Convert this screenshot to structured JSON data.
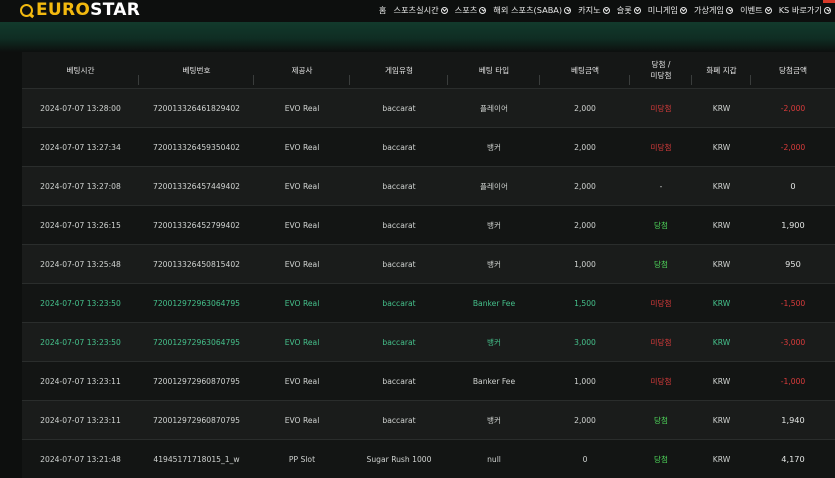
{
  "header": {
    "logo_euro": "EURO",
    "logo_star": "STAR",
    "nav": [
      {
        "label": "홈",
        "chevron": false
      },
      {
        "label": "스포츠실시간",
        "chevron": true
      },
      {
        "label": "스포츠",
        "chevron": true
      },
      {
        "label": "해외 스포츠(SABA)",
        "chevron": true
      },
      {
        "label": "카지노",
        "chevron": true
      },
      {
        "label": "슬롯",
        "chevron": true
      },
      {
        "label": "미니게임",
        "chevron": true
      },
      {
        "label": "가상게임",
        "chevron": true
      },
      {
        "label": "이벤트",
        "chevron": true
      },
      {
        "label": "KS 바로가기",
        "chevron": true
      }
    ]
  },
  "colors": {
    "logo_gold": "#f2b90f",
    "win_green": "#4ed65a",
    "lose_red": "#d93b3b",
    "highlight_row_text": "#45c08b"
  },
  "table": {
    "columns": [
      "베팅시간",
      "베팅번호",
      "제공사",
      "게임유형",
      "베팅 타입",
      "베팅금액",
      "당첨 /\n미당첨",
      "화폐 지갑",
      "당첨금액"
    ],
    "rows": [
      {
        "time": "2024-07-07 13:28:00",
        "bet_no": "720013326461829402",
        "provider": "EVO Real",
        "game": "baccarat",
        "bet_type": "플레이어",
        "amount": "2,000",
        "result": "미당첨",
        "result_class": "lose",
        "currency": "KRW",
        "win_amount": "-2,000",
        "win_class": "neg",
        "highlight": false
      },
      {
        "time": "2024-07-07 13:27:34",
        "bet_no": "720013326459350402",
        "provider": "EVO Real",
        "game": "baccarat",
        "bet_type": "뱅커",
        "amount": "2,000",
        "result": "미당첨",
        "result_class": "lose",
        "currency": "KRW",
        "win_amount": "-2,000",
        "win_class": "neg",
        "highlight": false
      },
      {
        "time": "2024-07-07 13:27:08",
        "bet_no": "720013326457449402",
        "provider": "EVO Real",
        "game": "baccarat",
        "bet_type": "플레이어",
        "amount": "2,000",
        "result": "-",
        "result_class": "",
        "currency": "KRW",
        "win_amount": "0",
        "win_class": "amt-white",
        "highlight": false
      },
      {
        "time": "2024-07-07 13:26:15",
        "bet_no": "720013326452799402",
        "provider": "EVO Real",
        "game": "baccarat",
        "bet_type": "뱅커",
        "amount": "2,000",
        "result": "당첨",
        "result_class": "win",
        "currency": "KRW",
        "win_amount": "1,900",
        "win_class": "amt-white",
        "highlight": false
      },
      {
        "time": "2024-07-07 13:25:48",
        "bet_no": "720013326450815402",
        "provider": "EVO Real",
        "game": "baccarat",
        "bet_type": "뱅커",
        "amount": "1,000",
        "result": "당첨",
        "result_class": "win",
        "currency": "KRW",
        "win_amount": "950",
        "win_class": "amt-white",
        "highlight": false
      },
      {
        "time": "2024-07-07 13:23:50",
        "bet_no": "720012972963064795",
        "provider": "EVO Real",
        "game": "baccarat",
        "bet_type": "Banker Fee",
        "amount": "1,500",
        "result": "미당첨",
        "result_class": "lose",
        "currency": "KRW",
        "win_amount": "-1,500",
        "win_class": "neg",
        "highlight": true
      },
      {
        "time": "2024-07-07 13:23:50",
        "bet_no": "720012972963064795",
        "provider": "EVO Real",
        "game": "baccarat",
        "bet_type": "뱅커",
        "amount": "3,000",
        "result": "미당첨",
        "result_class": "lose",
        "currency": "KRW",
        "win_amount": "-3,000",
        "win_class": "neg",
        "highlight": true
      },
      {
        "time": "2024-07-07 13:23:11",
        "bet_no": "720012972960870795",
        "provider": "EVO Real",
        "game": "baccarat",
        "bet_type": "Banker Fee",
        "amount": "1,000",
        "result": "미당첨",
        "result_class": "lose",
        "currency": "KRW",
        "win_amount": "-1,000",
        "win_class": "neg",
        "highlight": false
      },
      {
        "time": "2024-07-07 13:23:11",
        "bet_no": "720012972960870795",
        "provider": "EVO Real",
        "game": "baccarat",
        "bet_type": "뱅커",
        "amount": "2,000",
        "result": "당첨",
        "result_class": "win",
        "currency": "KRW",
        "win_amount": "1,940",
        "win_class": "amt-white",
        "highlight": false
      },
      {
        "time": "2024-07-07 13:21:48",
        "bet_no": "41945171718015_1_w",
        "provider": "PP Slot",
        "game": "Sugar Rush 1000",
        "bet_type": "null",
        "amount": "0",
        "result": "당첨",
        "result_class": "win",
        "currency": "KRW",
        "win_amount": "4,170",
        "win_class": "amt-white",
        "highlight": false
      }
    ]
  }
}
